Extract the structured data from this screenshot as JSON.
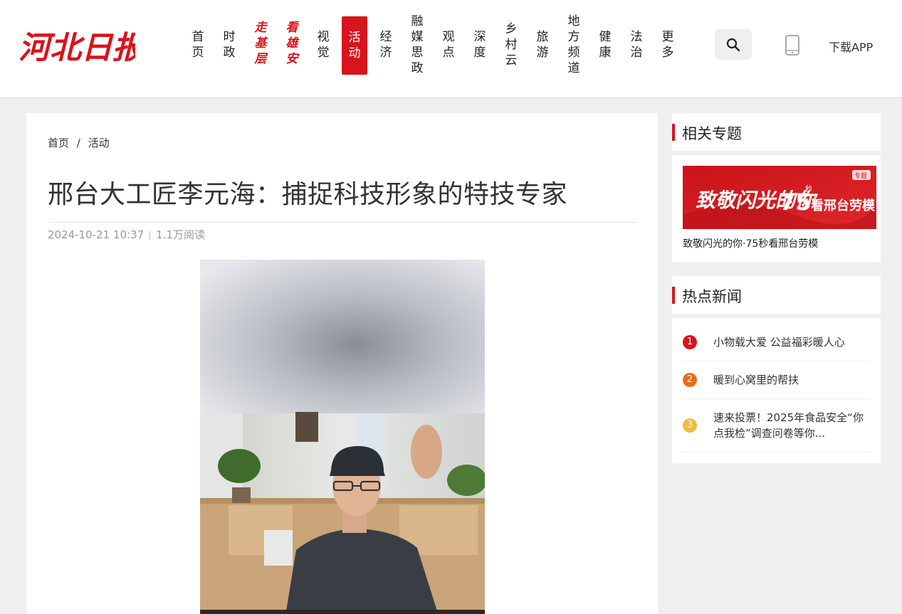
{
  "site": {
    "logo_text": "河北日报",
    "nav": [
      {
        "label": "首页",
        "lines": [
          "首",
          "页"
        ],
        "style": "normal"
      },
      {
        "label": "时政",
        "lines": [
          "时",
          "政"
        ],
        "style": "normal"
      },
      {
        "label": "走基层",
        "lines": [
          "走",
          "基",
          "层"
        ],
        "style": "brand"
      },
      {
        "label": "看雄安",
        "lines": [
          "看",
          "雄",
          "安"
        ],
        "style": "brand"
      },
      {
        "label": "视觉",
        "lines": [
          "视",
          "觉"
        ],
        "style": "normal"
      },
      {
        "label": "活动",
        "lines": [
          "活",
          "动"
        ],
        "style": "active"
      },
      {
        "label": "经济",
        "lines": [
          "经",
          "济"
        ],
        "style": "normal"
      },
      {
        "label": "融媒思政",
        "lines": [
          "融",
          "媒",
          "思",
          "政"
        ],
        "style": "normal"
      },
      {
        "label": "观点",
        "lines": [
          "观",
          "点"
        ],
        "style": "normal"
      },
      {
        "label": "深度",
        "lines": [
          "深",
          "度"
        ],
        "style": "normal"
      },
      {
        "label": "乡村云",
        "lines": [
          "乡",
          "村",
          "云"
        ],
        "style": "normal"
      },
      {
        "label": "旅游",
        "lines": [
          "旅",
          "游"
        ],
        "style": "normal"
      },
      {
        "label": "地方频道",
        "lines": [
          "地",
          "方",
          "频",
          "道"
        ],
        "style": "normal"
      },
      {
        "label": "健康",
        "lines": [
          "健",
          "康"
        ],
        "style": "normal"
      },
      {
        "label": "法治",
        "lines": [
          "法",
          "治"
        ],
        "style": "normal"
      },
      {
        "label": "更多",
        "lines": [
          "更",
          "多"
        ],
        "style": "normal"
      }
    ],
    "search_icon": "search-icon",
    "phone_icon": "phone-icon",
    "download_label": "下载APP",
    "brand_color": "#d8141c"
  },
  "article": {
    "breadcrumb": {
      "home": "首页",
      "sep": "/",
      "section": "活动"
    },
    "title": "邢台大工匠李元海：捕捉科技形象的特技专家",
    "date": "2024-10-21 10:37",
    "reads": "1.1万阅读"
  },
  "sidebar": {
    "topics_heading": "相关专题",
    "topic": {
      "banner_text": "致敬闪光的你",
      "banner_number": "75",
      "banner_unit": "秒",
      "banner_sub": "看邢台劳模",
      "banner_badge": "专题",
      "caption": "致敬闪光的你·75秒看邢台劳模"
    },
    "hot_heading": "热点新闻",
    "hot": [
      {
        "rank": "1",
        "title": "小物载大爱 公益福彩暖人心",
        "color": "#d8141c"
      },
      {
        "rank": "2",
        "title": "暖到心窝里的帮扶",
        "color": "#f06a1d"
      },
      {
        "rank": "3",
        "title": "速来投票！2025年食品安全“你点我检”调查问卷等你...",
        "color": "#f5bb3e"
      }
    ]
  }
}
